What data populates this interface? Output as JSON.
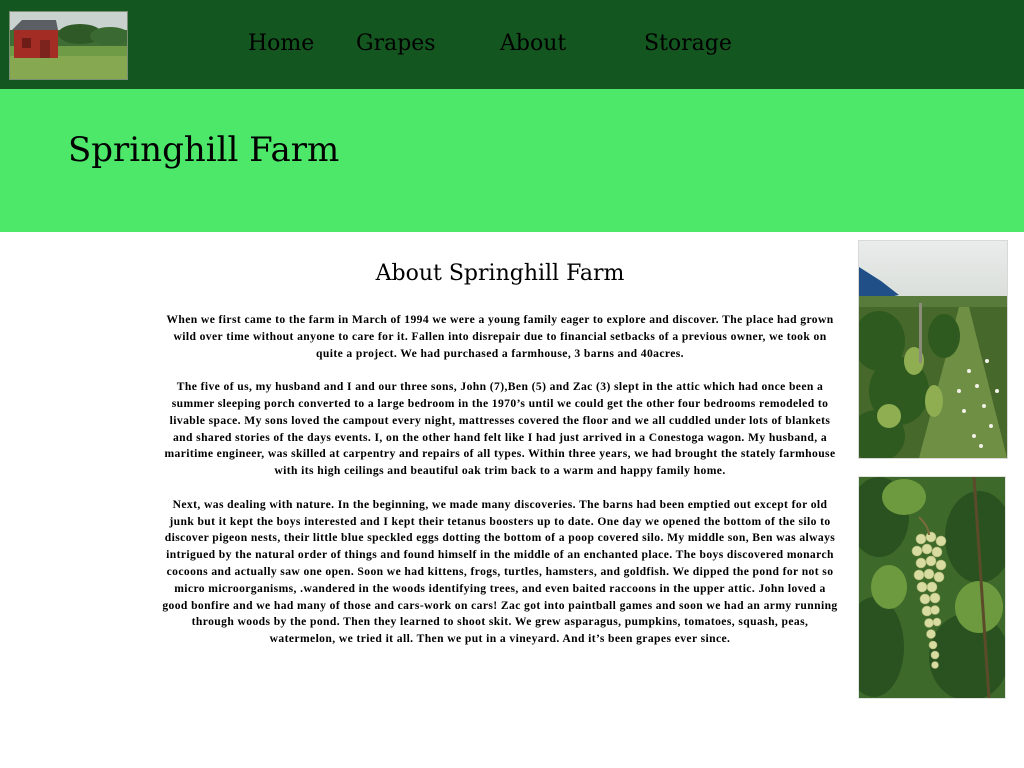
{
  "nav": {
    "logo_alt": "red barn photo",
    "items": [
      {
        "label": "Home"
      },
      {
        "label": "Grapes"
      },
      {
        "label": "About"
      },
      {
        "label": "Storage"
      }
    ]
  },
  "banner": {
    "title": "Springhill Farm"
  },
  "main": {
    "heading": "About Springhill Farm",
    "paragraphs": [
      "When we first came to the farm in March of 1994 we were a young family eager to explore and discover. The place had grown wild over time without anyone to care for it. Fallen into disrepair due to financial setbacks of a previous owner, we took on quite a project. We had purchased a farmhouse, 3 barns and 40acres.",
      "The five of us, my husband and I and our three sons, John (7),Ben (5) and Zac (3) slept in the attic which had once been a summer sleeping porch converted to a large bedroom in the 1970’s until we could get the other four bedrooms remodeled to livable space. My sons loved the campout every night, mattresses covered the floor and we all cuddled under lots of blankets and shared stories of the days events. I, on the other hand felt like I had just arrived in a Conestoga wagon. My husband, a maritime engineer, was skilled at carpentry and repairs of all types. Within three years, we had brought the stately farmhouse with its high ceilings and beautiful oak trim back to a warm and happy family home.",
      "Next, was dealing with nature. In the beginning, we made many discoveries. The barns had been emptied out except for old junk but it kept the boys interested and I kept their tetanus boosters up to date. One day we opened the bottom of the silo to discover pigeon nests, their little blue speckled eggs dotting the bottom of a poop covered silo. My middle son, Ben was always intrigued by the natural order of things and found himself in the middle of an enchanted place. The boys discovered monarch cocoons and actually saw one open. Soon we had kittens, frogs, turtles, hamsters, and goldfish. We dipped the pond for not so micro microorganisms, .wandered in the woods identifying trees, and even baited raccoons in the upper attic. John loved a good bonfire and we had many of those and cars-work on cars! Zac got into paintball games and soon we had an army running through woods by the pond. Then they learned to shoot skit. We grew asparagus, pumpkins, tomatoes, squash, peas, watermelon, we tried it all. Then we put in a vineyard. And it’s been grapes ever since."
    ]
  },
  "photos": {
    "vineyard_alt": "vineyard rows photo",
    "grapes_alt": "green grape cluster photo"
  },
  "colors": {
    "nav_bg": "#14561f",
    "banner_bg": "#4de86a",
    "page_bg": "#ffffff",
    "text": "#000000"
  }
}
